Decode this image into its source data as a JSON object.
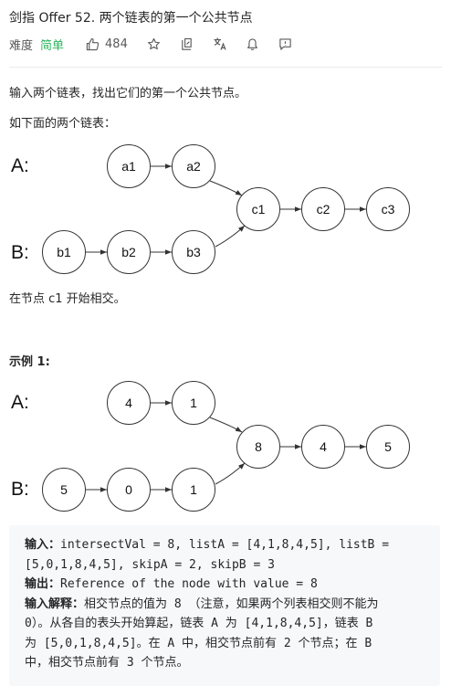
{
  "problem": {
    "title": "剑指 Offer 52. 两个链表的第一个公共节点",
    "difficulty_label": "难度",
    "difficulty": "简单",
    "likes": "484"
  },
  "toolbar": {
    "icons": [
      "thumbs-up-icon",
      "star-icon",
      "share-icon",
      "translate-icon",
      "bell-icon",
      "feedback-icon"
    ]
  },
  "description": {
    "intro": "输入两个链表，找出它们的第一个公共节点。",
    "example_intro": "如下面的两个链表：",
    "intersection_note": "在节点 c1 开始相交。",
    "example_heading": "示例 1:"
  },
  "diagram1": {
    "label_a": "A:",
    "label_b": "B:",
    "list_a": [
      "a1",
      "a2"
    ],
    "list_b": [
      "b1",
      "b2",
      "b3"
    ],
    "shared": [
      "c1",
      "c2",
      "c3"
    ]
  },
  "diagram2": {
    "label_a": "A:",
    "label_b": "B:",
    "list_a": [
      "4",
      "1"
    ],
    "list_b": [
      "5",
      "0",
      "1"
    ],
    "shared": [
      "8",
      "4",
      "5"
    ]
  },
  "example": {
    "input_label": "输入：",
    "input_line1": "intersectVal = 8, listA = [4,1,8,4,5], listB =",
    "input_line2": "[5,0,1,8,4,5], skipA = 2, skipB = 3",
    "output_label": "输出：",
    "output_value": "Reference of the node with value = 8",
    "explain_label": "输入解释：",
    "explain_line1": "相交节点的值为 8 （注意，如果两个列表相交则不能为",
    "explain_line2": "0）。从各自的表头开始算起，链表 A 为 [4,1,8,4,5]，链表 B",
    "explain_line3": "为 [5,0,1,8,4,5]。在 A 中，相交节点前有 2 个节点；在 B",
    "explain_line4": "中，相交节点前有 3 个节点。"
  }
}
